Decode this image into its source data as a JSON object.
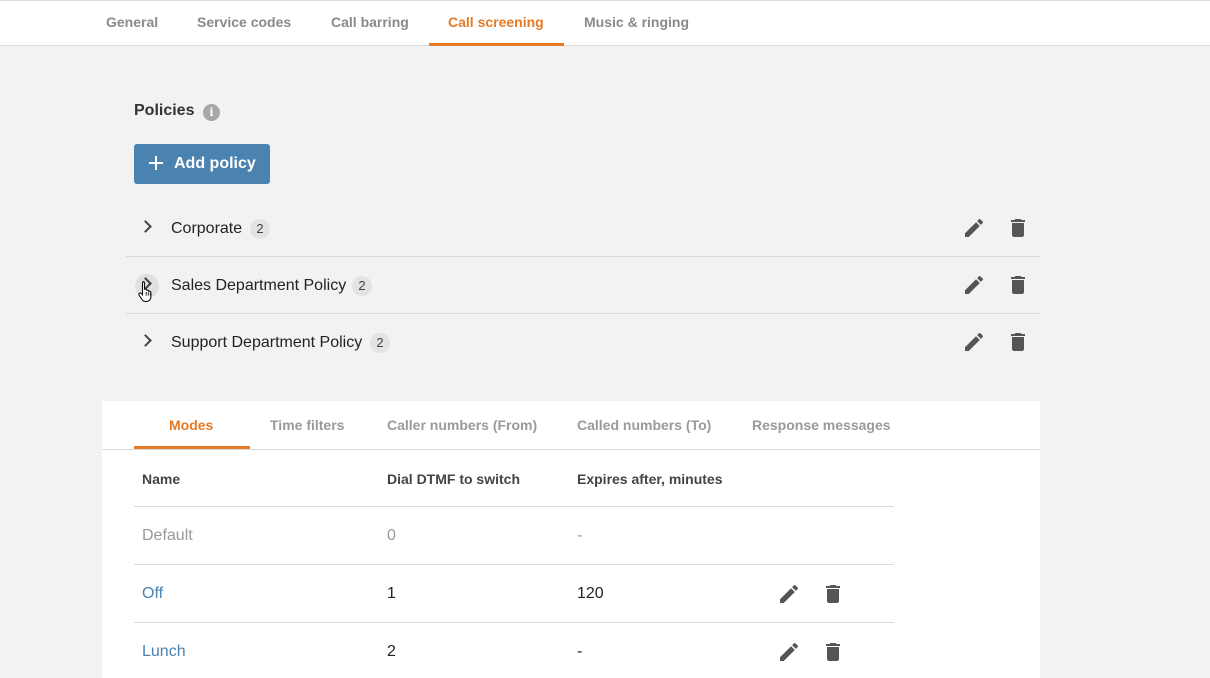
{
  "top_tabs": [
    {
      "label": "General"
    },
    {
      "label": "Service codes"
    },
    {
      "label": "Call barring"
    },
    {
      "label": "Call screening",
      "active": true
    },
    {
      "label": "Music & ringing"
    }
  ],
  "policies": {
    "title": "Policies",
    "info_icon": "i",
    "add_button": "Add policy",
    "items": [
      {
        "name": "Corporate",
        "count": "2"
      },
      {
        "name": "Sales Department Policy",
        "count": "2"
      },
      {
        "name": "Support Department Policy",
        "count": "2"
      }
    ]
  },
  "detail": {
    "tabs": [
      {
        "label": "Modes",
        "active": true
      },
      {
        "label": "Time filters"
      },
      {
        "label": "Caller numbers (From)"
      },
      {
        "label": "Called numbers (To)"
      },
      {
        "label": "Response messages"
      }
    ],
    "columns": [
      "Name",
      "Dial DTMF to switch",
      "Expires after, minutes"
    ],
    "rows": [
      {
        "name": "Default",
        "dtmf": "0",
        "expires": "-"
      },
      {
        "name": "Off",
        "dtmf": "1",
        "expires": "120"
      },
      {
        "name": "Lunch",
        "dtmf": "2",
        "expires": "-"
      }
    ]
  },
  "colors": {
    "accent": "#e57b27",
    "primary": "#4a82b0",
    "background": "#f1f2f1"
  },
  "icons": [
    "info-icon",
    "plus-icon",
    "chevron-right-icon",
    "pencil-icon",
    "trash-icon",
    "hand-pointer-cursor-icon"
  ]
}
